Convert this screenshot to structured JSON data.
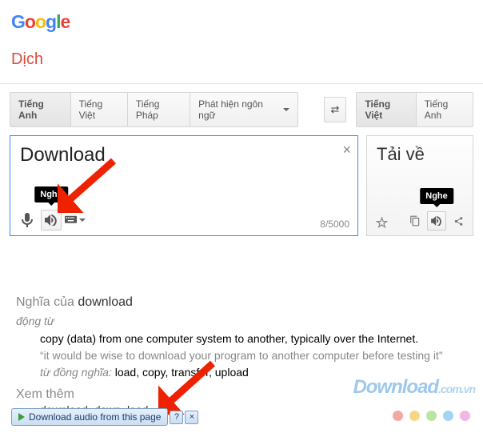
{
  "logo": {
    "g1": "G",
    "o1": "o",
    "o2": "o",
    "g2": "g",
    "l": "l",
    "e": "e"
  },
  "app_name": "Dịch",
  "src_langs": [
    {
      "label": "Tiếng Anh",
      "active": true
    },
    {
      "label": "Tiếng Việt",
      "active": false
    },
    {
      "label": "Tiếng Pháp",
      "active": false
    }
  ],
  "detect_label": "Phát hiện ngôn ngữ",
  "tgt_langs": [
    {
      "label": "Tiếng Việt",
      "active": true
    },
    {
      "label": "Tiếng Anh",
      "active": false
    }
  ],
  "input": {
    "text": "Download",
    "char_count": "8/5000",
    "clear": "×"
  },
  "output": {
    "text": "Tải về"
  },
  "tooltip_listen": "Nghe",
  "definitions": {
    "title_prefix": "Nghĩa của ",
    "word": "download",
    "pos": "động từ",
    "def": "copy (data) from one computer system to another, typically over the Internet.",
    "example": "“it would be wise to download your program to another computer before testing it”",
    "syn_label": "từ đồng nghĩa:",
    "syn_list": " load, copy, transfer, upload",
    "see_also": "Xem thêm",
    "see_items": "download, down, load"
  },
  "dl_bar": {
    "label": "Download audio from this page",
    "help": "?",
    "close": "×"
  },
  "watermark": {
    "main": "Download",
    "suffix": ".com.vn"
  },
  "dot_colors": [
    "#f4a7a7",
    "#f6d786",
    "#b9e5a0",
    "#a3d4f0",
    "#f1b7e2"
  ]
}
